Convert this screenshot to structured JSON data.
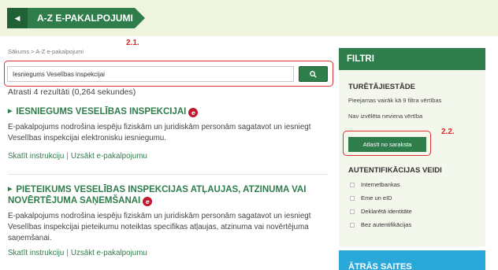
{
  "header": {
    "title": "A-Z E-PAKALPOJUMI",
    "back_icon": "chevron-left-icon"
  },
  "annotations": {
    "search_marker": "2.1.",
    "select_marker": "2.2."
  },
  "breadcrumb": "Sākums > A-Z e-pakalpojumi",
  "search": {
    "value": "Iesniegums Veselības inspekcijai",
    "button_icon": "search-icon"
  },
  "results_count": "Atrasti 4 rezultāti (0,264 sekundes)",
  "results": [
    {
      "title": "IESNIEGUMS VESELĪBAS INSPEKCIJAI",
      "badge": "e",
      "description": "E-pakalpojums nodrošina iespēju fiziskām un juridiskām personām sagatavot un iesniegt Veselības inspekcijai elektronisku iesniegumu.",
      "link_instructions": "Skatīt instrukciju",
      "separator": "|",
      "link_start": "Uzsākt e-pakalpojumu"
    },
    {
      "title": "PIETEIKUMS VESELĪBAS INSPEKCIJAS ATĻAUJAS, ATZINUMA VAI NOVĒRTĒJUMA SAŅEMŠANAI",
      "badge": "e",
      "description": "E-pakalpojums nodrošina iespēju fiziskām un juridiskām personām sagatavot un iesniegt Veselības inspekcijai pieteikumu noteiktas specifikas atļaujas, atzinuma vai novērtējuma saņemšanai.",
      "link_instructions": "Skatīt instrukciju",
      "separator": "|",
      "link_start": "Uzsākt e-pakalpojumu"
    }
  ],
  "sidebar": {
    "header": "FILTRI",
    "agency_title": "TURĒTĀJIESTĀDE",
    "agency_note": "Pieejamas vairāk kā 9 filtra vērtības",
    "agency_selected": "Nav izvēlēta neviena vērtība",
    "select_button": "Atlasīt no saraksta",
    "auth_title": "AUTENTIFIKĀCIJAS VEIDI",
    "auth_options": [
      "Internetbankas",
      "Eme un eID",
      "Deklarētā identitāte",
      "Bez autentifikācijas"
    ],
    "fast_links": "ĀTRĀS SAITES"
  },
  "colors": {
    "brand": "#2e7d4a",
    "accent": "#2aa8d9",
    "badge": "#c01830",
    "annotation": "#e03030"
  }
}
